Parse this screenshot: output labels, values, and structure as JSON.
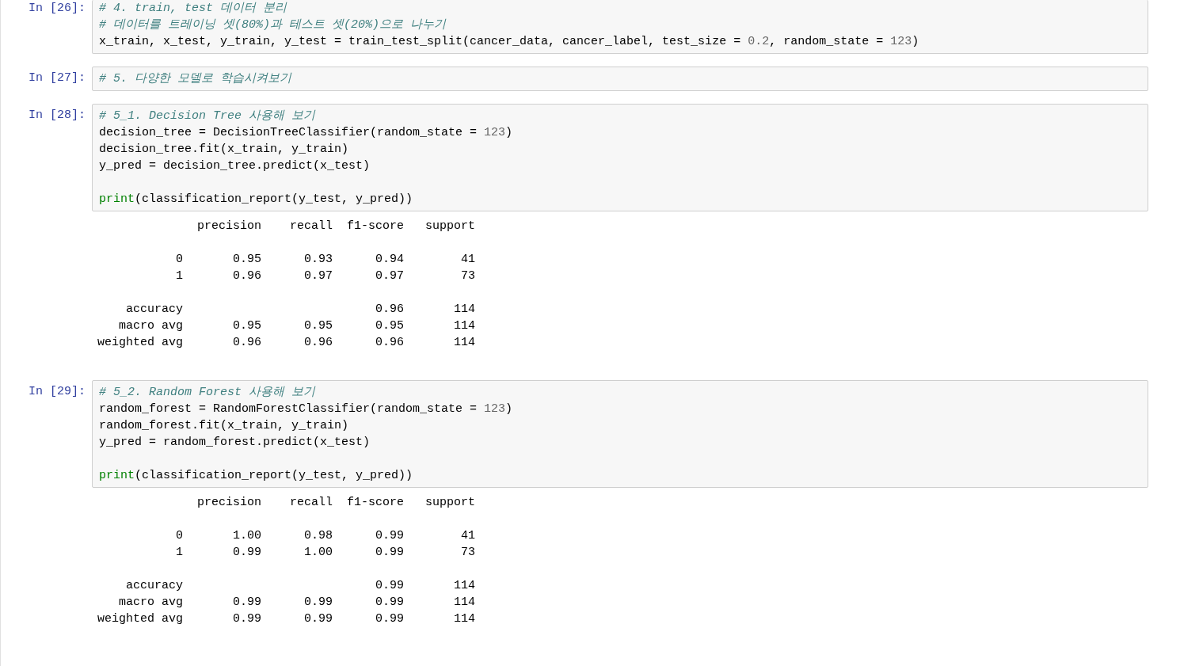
{
  "cells": [
    {
      "prompt": "In [26]:",
      "code_blocks": [
        [
          [
            {
              "kind": "comment",
              "text": "# 4. train, test 데이터 분리"
            }
          ],
          [
            {
              "kind": "comment",
              "text": "# 데이터를 트레이닝 셋(80%)과 테스트 셋(20%)으로 나누기"
            }
          ],
          [
            {
              "kind": "plain",
              "text": "x_train, x_test, y_train, y_test = train_test_split(cancer_data, cancer_label, test_size = "
            },
            {
              "kind": "number",
              "text": "0.2"
            },
            {
              "kind": "plain",
              "text": ", random_state = "
            },
            {
              "kind": "number",
              "text": "123"
            },
            {
              "kind": "plain",
              "text": ")"
            }
          ]
        ]
      ]
    },
    {
      "prompt": "In [27]:",
      "code_blocks": [
        [
          [
            {
              "kind": "comment",
              "text": "# 5. 다양한 모델로 학습시켜보기"
            }
          ]
        ]
      ]
    },
    {
      "prompt": "In [28]:",
      "code_blocks": [
        [
          [
            {
              "kind": "comment",
              "text": "# 5_1. Decision Tree 사용해 보기"
            }
          ],
          [
            {
              "kind": "plain",
              "text": "decision_tree = DecisionTreeClassifier(random_state = "
            },
            {
              "kind": "number",
              "text": "123"
            },
            {
              "kind": "plain",
              "text": ")"
            }
          ],
          [
            {
              "kind": "plain",
              "text": "decision_tree.fit(x_train, y_train)"
            }
          ],
          [
            {
              "kind": "plain",
              "text": "y_pred = decision_tree.predict(x_test)"
            }
          ]
        ],
        [
          [
            {
              "kind": "builtin",
              "text": "print"
            },
            {
              "kind": "plain",
              "text": "(classification_report(y_test, y_pred))"
            }
          ]
        ]
      ],
      "output_blocks": [
        [
          "              precision    recall  f1-score   support"
        ],
        [
          "           0       0.95      0.93      0.94        41",
          "           1       0.96      0.97      0.97        73"
        ],
        [
          "    accuracy                           0.96       114",
          "   macro avg       0.95      0.95      0.95       114",
          "weighted avg       0.96      0.96      0.96       114"
        ]
      ]
    },
    {
      "prompt": "In [29]:",
      "code_blocks": [
        [
          [
            {
              "kind": "comment",
              "text": "# 5_2. Random Forest 사용해 보기"
            }
          ],
          [
            {
              "kind": "plain",
              "text": "random_forest = RandomForestClassifier(random_state = "
            },
            {
              "kind": "number",
              "text": "123"
            },
            {
              "kind": "plain",
              "text": ")"
            }
          ],
          [
            {
              "kind": "plain",
              "text": "random_forest.fit(x_train, y_train)"
            }
          ],
          [
            {
              "kind": "plain",
              "text": "y_pred = random_forest.predict(x_test)"
            }
          ]
        ],
        [
          [
            {
              "kind": "builtin",
              "text": "print"
            },
            {
              "kind": "plain",
              "text": "(classification_report(y_test, y_pred))"
            }
          ]
        ]
      ],
      "output_blocks": [
        [
          "              precision    recall  f1-score   support"
        ],
        [
          "           0       1.00      0.98      0.99        41",
          "           1       0.99      1.00      0.99        73"
        ],
        [
          "    accuracy                           0.99       114",
          "   macro avg       0.99      0.99      0.99       114",
          "weighted avg       0.99      0.99      0.99       114"
        ]
      ]
    }
  ]
}
